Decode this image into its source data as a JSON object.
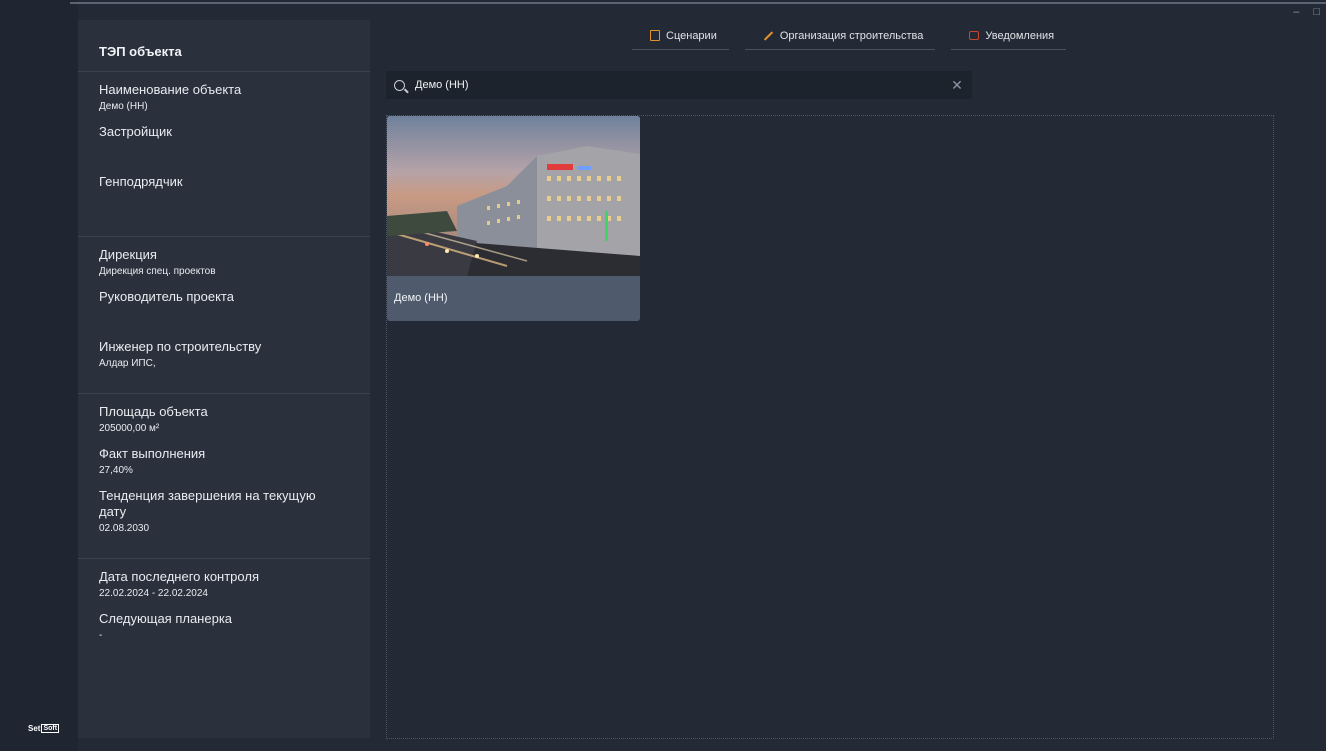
{
  "window": {
    "minimize": "–",
    "maximize": "□"
  },
  "sidebar": {
    "title": "ТЭП объекта",
    "sections": [
      [
        {
          "label": "Наименование объекта",
          "value": "Демо (НН)"
        },
        {
          "label": "Застройщик",
          "value": ""
        },
        {
          "label": "Генподрядчик",
          "value": ""
        }
      ],
      [
        {
          "label": "Дирекция",
          "value": "Дирекция спец. проектов"
        },
        {
          "label": "Руководитель проекта",
          "value": ""
        },
        {
          "label": "Инженер по строительству",
          "value": "Алдар ИПС,"
        }
      ],
      [
        {
          "label": "Площадь объекта",
          "value": "205000,00 м²"
        },
        {
          "label": "Факт выполнения",
          "value": "27,40%"
        },
        {
          "label": "Тенденция завершения на текущую дату",
          "value": "02.08.2030"
        }
      ],
      [
        {
          "label": "Дата последнего контроля",
          "value": "22.02.2024 - 22.02.2024"
        },
        {
          "label": "Следующая планерка",
          "value": "-"
        }
      ]
    ]
  },
  "tabs": [
    {
      "label": "Сценарии",
      "icon": "clipboard-icon"
    },
    {
      "label": "Организация строительства",
      "icon": "pencil-icon"
    },
    {
      "label": "Уведомления",
      "icon": "notification-icon"
    }
  ],
  "search": {
    "value": "Демо (НН)",
    "clear": "✕"
  },
  "projects": [
    {
      "name": "Демо (НН)"
    }
  ],
  "logo": {
    "text": "Set",
    "boxed": "Soft"
  },
  "colors": {
    "accent": "#e3922a",
    "notification": "#c7452c",
    "background": "#232a36",
    "panel": "#2a313d"
  }
}
